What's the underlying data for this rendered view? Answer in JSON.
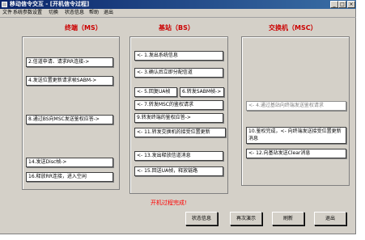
{
  "window": {
    "title": "移动信令交互 - [开机信令过程]",
    "minimize_glyph": "_",
    "maximize_glyph": "□",
    "close_glyph": "×"
  },
  "menu": [
    "文件",
    "系统参数设置",
    "切换",
    "状态信息",
    "帮助",
    "退出"
  ],
  "columns": {
    "ms": "终端（MS）",
    "bs": "基站（BS）",
    "msc": "交换机（MSC）"
  },
  "messages": {
    "ms_1": "2.信道申请、请求RR连接->",
    "ms_2": "4.发送位置更新请求帧SABM->",
    "ms_3": "8.通过BS向MSC发送鉴权应答->",
    "ms_4": "14.发送Disc帧->",
    "ms_5": "16.释放RR连接，进入空闲",
    "bs_1": "<- 1.发出系统信息",
    "bs_2": "<- 3.确认后立即分配信道",
    "bs_3": "<- 5.回复UA帧",
    "bs_4": "6.转发SABM帧->",
    "bs_5": "<- 7.转发MSC的鉴权请求",
    "bs_6": "9.转发终端的鉴权应答->",
    "bs_7": "<- 11.转发交换机的接受位置更新",
    "bs_8": "<- 13.发出释放信道消息",
    "bs_9": "<- 15.回送UA帧，释放链路",
    "msc_1": "<- 4.通过基站向终端发送鉴权请求",
    "msc_2": "10.鉴权完成，<- 向终端发送接受位置更新消息",
    "msc_3": "<- 12.向基站发送Clear消息"
  },
  "status_text": "开机过程完成!",
  "buttons": {
    "status_info": "状态信息",
    "replay": "再次演示",
    "refresh": "刷新",
    "exit": "退出"
  }
}
